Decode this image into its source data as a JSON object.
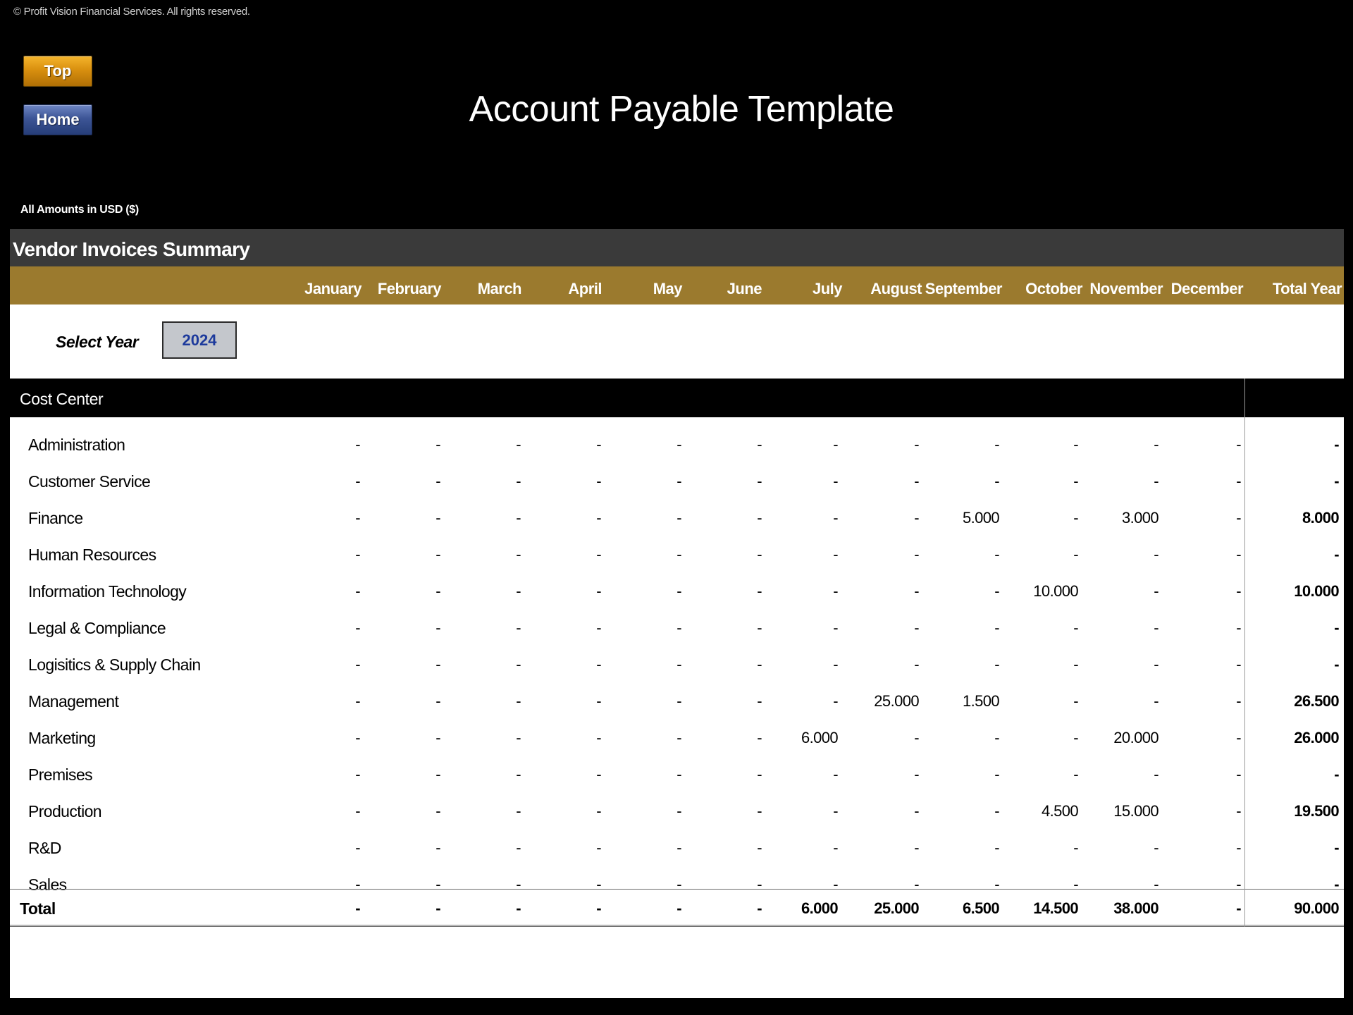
{
  "copyright": "© Profit Vision Financial Services. All rights reserved.",
  "nav": {
    "top_label": "Top",
    "home_label": "Home"
  },
  "title": "Account Payable Template",
  "amounts_note": "All Amounts in  USD ($)",
  "section_title": "Vendor Invoices Summary",
  "months": [
    "January",
    "February",
    "March",
    "April",
    "May",
    "June",
    "July",
    "August",
    "September",
    "October",
    "November",
    "December",
    "Total Year"
  ],
  "select_year": {
    "label": "Select Year",
    "value": "2024"
  },
  "cost_center_label": "Cost Center",
  "rows": [
    {
      "name": "Administration",
      "values": [
        "-",
        "-",
        "-",
        "-",
        "-",
        "-",
        "-",
        "-",
        "-",
        "-",
        "-",
        "-",
        "-"
      ]
    },
    {
      "name": "Customer Service",
      "values": [
        "-",
        "-",
        "-",
        "-",
        "-",
        "-",
        "-",
        "-",
        "-",
        "-",
        "-",
        "-",
        "-"
      ]
    },
    {
      "name": "Finance",
      "values": [
        "-",
        "-",
        "-",
        "-",
        "-",
        "-",
        "-",
        "-",
        "5.000",
        "-",
        "3.000",
        "-",
        "8.000"
      ]
    },
    {
      "name": "Human Resources",
      "values": [
        "-",
        "-",
        "-",
        "-",
        "-",
        "-",
        "-",
        "-",
        "-",
        "-",
        "-",
        "-",
        "-"
      ]
    },
    {
      "name": "Information Technology",
      "values": [
        "-",
        "-",
        "-",
        "-",
        "-",
        "-",
        "-",
        "-",
        "-",
        "10.000",
        "-",
        "-",
        "10.000"
      ]
    },
    {
      "name": "Legal & Compliance",
      "values": [
        "-",
        "-",
        "-",
        "-",
        "-",
        "-",
        "-",
        "-",
        "-",
        "-",
        "-",
        "-",
        "-"
      ]
    },
    {
      "name": "Logisitics & Supply Chain",
      "values": [
        "-",
        "-",
        "-",
        "-",
        "-",
        "-",
        "-",
        "-",
        "-",
        "-",
        "-",
        "-",
        "-"
      ]
    },
    {
      "name": "Management",
      "values": [
        "-",
        "-",
        "-",
        "-",
        "-",
        "-",
        "-",
        "25.000",
        "1.500",
        "-",
        "-",
        "-",
        "26.500"
      ]
    },
    {
      "name": "Marketing",
      "values": [
        "-",
        "-",
        "-",
        "-",
        "-",
        "-",
        "6.000",
        "-",
        "-",
        "-",
        "20.000",
        "-",
        "26.000"
      ]
    },
    {
      "name": "Premises",
      "values": [
        "-",
        "-",
        "-",
        "-",
        "-",
        "-",
        "-",
        "-",
        "-",
        "-",
        "-",
        "-",
        "-"
      ]
    },
    {
      "name": "Production",
      "values": [
        "-",
        "-",
        "-",
        "-",
        "-",
        "-",
        "-",
        "-",
        "-",
        "4.500",
        "15.000",
        "-",
        "19.500"
      ]
    },
    {
      "name": "R&D",
      "values": [
        "-",
        "-",
        "-",
        "-",
        "-",
        "-",
        "-",
        "-",
        "-",
        "-",
        "-",
        "-",
        "-"
      ]
    },
    {
      "name": "Sales",
      "values": [
        "-",
        "-",
        "-",
        "-",
        "-",
        "-",
        "-",
        "-",
        "-",
        "-",
        "-",
        "-",
        "-"
      ]
    }
  ],
  "total": {
    "label": "Total",
    "values": [
      "-",
      "-",
      "-",
      "-",
      "-",
      "-",
      "6.000",
      "25.000",
      "6.500",
      "14.500",
      "38.000",
      "-",
      "90.000"
    ]
  }
}
